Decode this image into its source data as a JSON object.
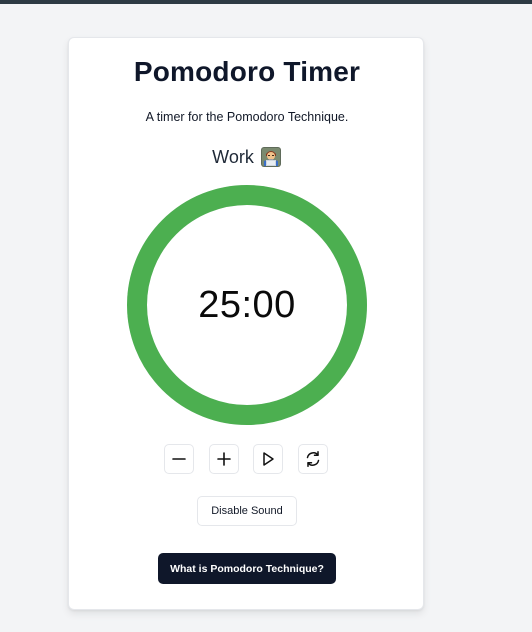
{
  "app": {
    "title": "Pomodoro Timer",
    "subtitle": "A timer for the Pomodoro Technique."
  },
  "mode": {
    "label": "Work",
    "icon": "technologist-emoji-icon"
  },
  "timer": {
    "display": "25:00",
    "progress_fraction": 1.0,
    "ring_color": "#4caf50"
  },
  "controls": {
    "decrease_icon": "minus-icon",
    "increase_icon": "plus-icon",
    "play_icon": "play-icon",
    "reset_icon": "refresh-icon"
  },
  "sound_button": {
    "label": "Disable Sound"
  },
  "info_button": {
    "label": "What is Pomodoro Technique?"
  },
  "colors": {
    "accent": "#4caf50",
    "dark_button": "#0f172a",
    "page_background": "#f3f4f6"
  }
}
